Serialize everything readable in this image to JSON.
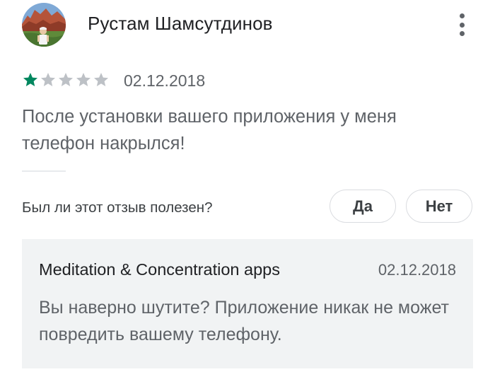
{
  "review": {
    "author": "Рустам Шамсутдинов",
    "rating": 1,
    "rating_max": 5,
    "date": "02.12.2018",
    "text": "После установки вашего приложения у меня телефон накрылся!"
  },
  "helpful": {
    "question": "Был ли этот отзыв полезен?",
    "yes_label": "Да",
    "no_label": "Нет"
  },
  "reply": {
    "developer": "Meditation & Concentration apps",
    "date": "02.12.2018",
    "text": "Вы наверно шутите? Приложение никак не может повредить вашему телефону."
  },
  "icons": {
    "avatar": "avatar-photo",
    "menu": "more-vert-icon",
    "star_filled": "star-filled-icon",
    "star_empty": "star-empty-icon"
  },
  "colors": {
    "star_filled": "#01875f",
    "star_empty": "#bdc1c6",
    "reply_bg": "#f1f3f4"
  }
}
